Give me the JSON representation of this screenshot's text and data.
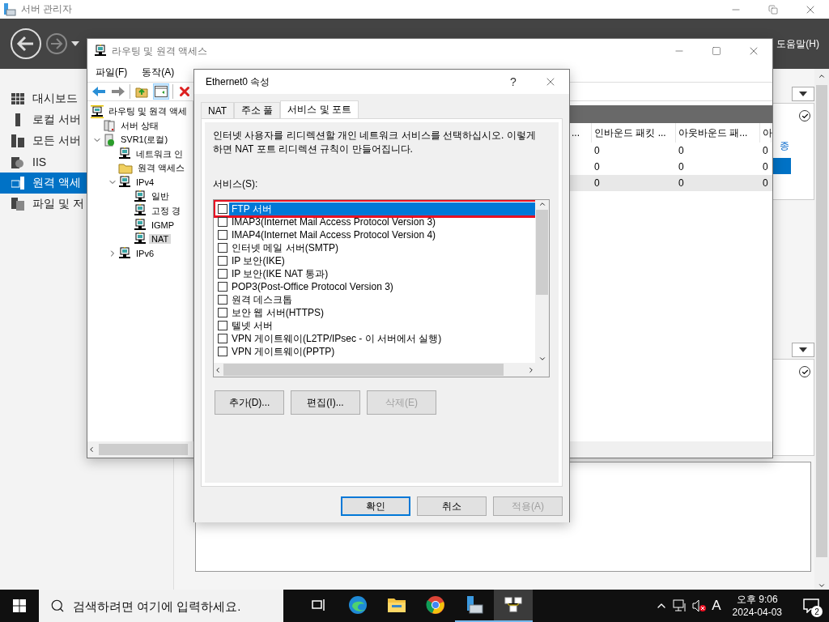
{
  "server_manager": {
    "title": "서버 관리자",
    "help_menu": "도움말(H)",
    "sidebar": [
      {
        "label": "대시보드",
        "kind": "dashboard",
        "selected": false
      },
      {
        "label": "로컬 서버",
        "kind": "local",
        "selected": false
      },
      {
        "label": "모든 서버",
        "kind": "all",
        "selected": false
      },
      {
        "label": "IIS",
        "kind": "iis",
        "selected": false
      },
      {
        "label": "원격 액세",
        "kind": "remote",
        "selected": true
      },
      {
        "label": "파일 및 저",
        "kind": "files",
        "selected": false
      }
    ],
    "side_link": "종"
  },
  "mmc": {
    "title": "라우팅 및 원격 액세스",
    "menu": [
      "파일(F)",
      "동작(A)"
    ],
    "tree": [
      {
        "label": "라우팅 및 원격 액세",
        "kind": "root",
        "selected": false,
        "children": [
          {
            "label": "서버 상태",
            "kind": "servers",
            "selected": false
          },
          {
            "label": "SVR1(로컬)",
            "kind": "server",
            "selected": false,
            "expanded": true,
            "children": [
              {
                "label": "네트워크 인",
                "kind": "router",
                "selected": false
              },
              {
                "label": "원격 액세스",
                "kind": "folder",
                "selected": false
              },
              {
                "label": "IPv4",
                "kind": "router",
                "selected": false,
                "expanded": true,
                "children": [
                  {
                    "label": "일반",
                    "kind": "router",
                    "selected": false
                  },
                  {
                    "label": "고정 경",
                    "kind": "router",
                    "selected": false
                  },
                  {
                    "label": "IGMP",
                    "kind": "router",
                    "selected": false
                  },
                  {
                    "label": "NAT",
                    "kind": "router",
                    "selected": true
                  }
                ]
              },
              {
                "label": "IPv6",
                "kind": "router",
                "selected": false,
                "expanded": false
              }
            ]
          }
        ]
      }
    ],
    "table": {
      "hidden_column": "...",
      "columns": [
        "인바운드 패킷 ...",
        "아웃바운드 패...",
        "아"
      ],
      "rows": [
        {
          "cells": [
            "0",
            "0",
            "0"
          ],
          "selected": false
        },
        {
          "cells": [
            "0",
            "0",
            "0"
          ],
          "selected": false
        },
        {
          "cells": [
            "0",
            "0",
            "0"
          ],
          "selected": true
        }
      ]
    }
  },
  "dialog": {
    "title": "Ethernet0 속성",
    "help": "?",
    "tabs": [
      {
        "label": "NAT",
        "selected": false
      },
      {
        "label": "주소 풀",
        "selected": false
      },
      {
        "label": "서비스 및 포트",
        "selected": true
      }
    ],
    "description": "인터넷 사용자를 리디렉션할 개인 네트워크 서비스를 선택하십시오. 이렇게 하면 NAT 포트 리디렉션 규칙이 만들어집니다.",
    "services_label": "서비스(S):",
    "services": [
      {
        "label": "FTP 서버",
        "checked": false,
        "selected": true,
        "highlighted": true
      },
      {
        "label": "IMAP3(Internet Mail Access Protocol Version 3)",
        "checked": false,
        "selected": false,
        "highlighted": false
      },
      {
        "label": "IMAP4(Internet Mail Access Protocol Version 4)",
        "checked": false,
        "selected": false,
        "highlighted": false
      },
      {
        "label": "인터넷 메일 서버(SMTP)",
        "checked": false,
        "selected": false,
        "highlighted": false
      },
      {
        "label": "IP 보안(IKE)",
        "checked": false,
        "selected": false,
        "highlighted": false
      },
      {
        "label": "IP 보안(IKE NAT 통과)",
        "checked": false,
        "selected": false,
        "highlighted": false
      },
      {
        "label": "POP3(Post-Office Protocol Version 3)",
        "checked": false,
        "selected": false,
        "highlighted": false
      },
      {
        "label": "원격 데스크톱",
        "checked": false,
        "selected": false,
        "highlighted": false
      },
      {
        "label": "보안 웹 서버(HTTPS)",
        "checked": false,
        "selected": false,
        "highlighted": false
      },
      {
        "label": "텔넷 서버",
        "checked": false,
        "selected": false,
        "highlighted": false
      },
      {
        "label": "VPN 게이트웨이(L2TP/IPsec - 이 서버에서 실행)",
        "checked": false,
        "selected": false,
        "highlighted": false
      },
      {
        "label": "VPN 게이트웨이(PPTP)",
        "checked": false,
        "selected": false,
        "highlighted": false
      }
    ],
    "actions": [
      {
        "label": "추가(D)...",
        "disabled": false
      },
      {
        "label": "편집(I)...",
        "disabled": false
      },
      {
        "label": "삭제(E)",
        "disabled": true
      }
    ],
    "footer": [
      {
        "label": "확인",
        "default": true,
        "disabled": false
      },
      {
        "label": "취소",
        "default": false,
        "disabled": false
      },
      {
        "label": "적용(A)",
        "default": false,
        "disabled": true
      }
    ]
  },
  "taskbar": {
    "search_placeholder": "검색하려면 여기에 입력하세요.",
    "apps": [
      {
        "kind": "task-view",
        "running": false,
        "active": false
      },
      {
        "kind": "edge",
        "running": false,
        "active": false
      },
      {
        "kind": "explorer",
        "running": false,
        "active": false
      },
      {
        "kind": "chrome",
        "running": false,
        "active": false
      },
      {
        "kind": "server-manager",
        "running": true,
        "active": false
      },
      {
        "kind": "routing",
        "running": true,
        "active": true
      }
    ],
    "ime": "A",
    "time": "오후 9:06",
    "date": "2024-04-03",
    "notifications": "2"
  }
}
